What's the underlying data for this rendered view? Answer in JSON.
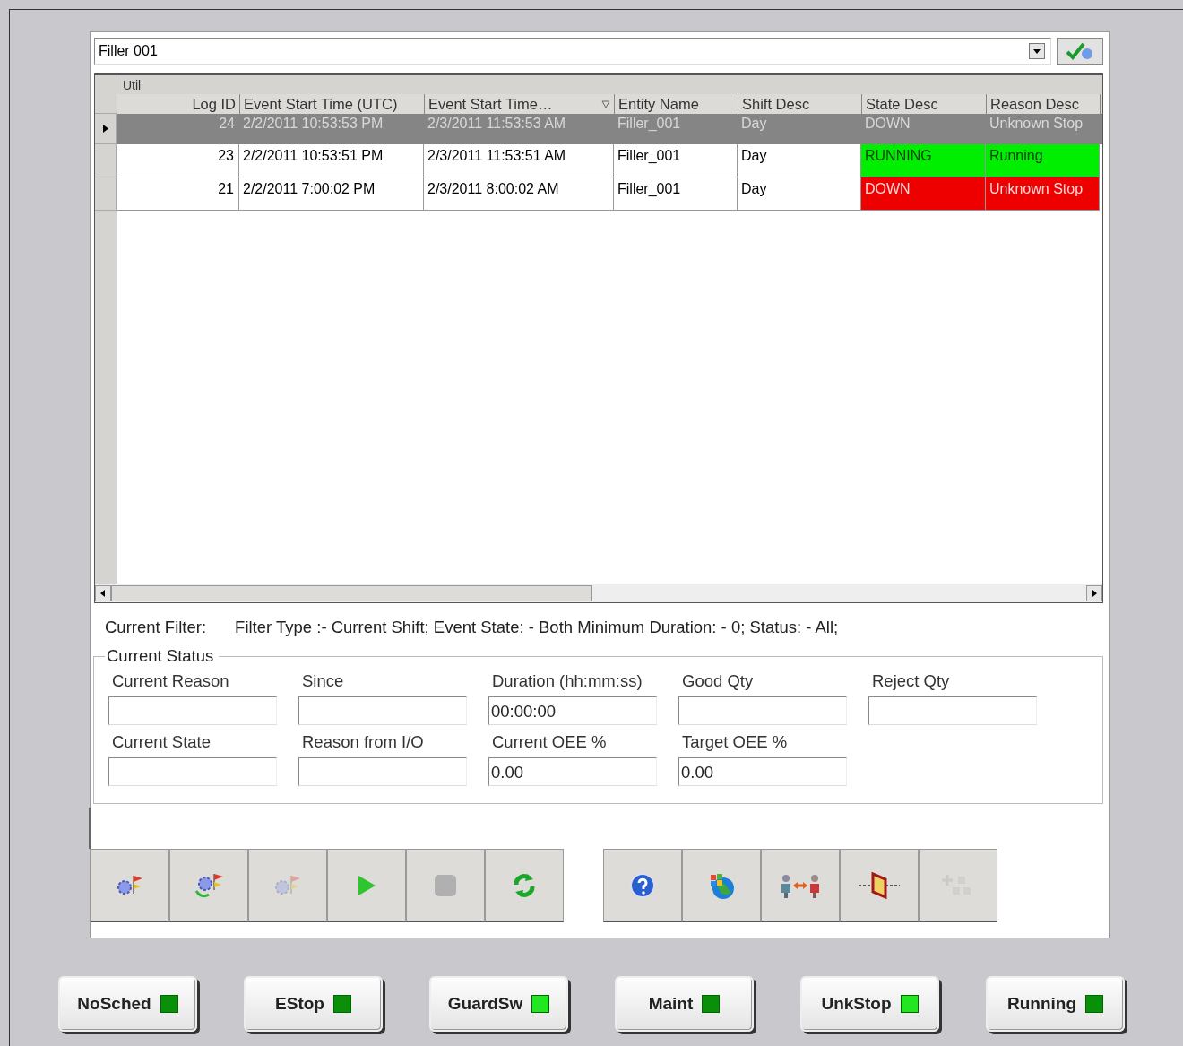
{
  "selector": {
    "value": "Filler 001"
  },
  "grid": {
    "group_header": "Util",
    "columns": [
      {
        "label": "Log ID",
        "sorted": false
      },
      {
        "label": "Event Start Time (UTC)",
        "sorted": false
      },
      {
        "label": "Event Start Time…",
        "sorted": true
      },
      {
        "label": "Entity Name",
        "sorted": false
      },
      {
        "label": "Shift Desc",
        "sorted": false
      },
      {
        "label": "State Desc",
        "sorted": false
      },
      {
        "label": "Reason Desc",
        "sorted": false
      }
    ],
    "rows": [
      {
        "selected": true,
        "cells": [
          "24",
          "2/2/2011 10:53:53 PM",
          "2/3/2011 11:53:53 AM",
          "Filler_001",
          "Day",
          "DOWN",
          "Unknown Stop"
        ]
      },
      {
        "selected": false,
        "color": "#00ee00",
        "cells": [
          "23",
          "2/2/2011 10:53:51 PM",
          "2/3/2011 11:53:51 AM",
          "Filler_001",
          "Day",
          "RUNNING",
          "Running"
        ]
      },
      {
        "selected": false,
        "color": "#ee0000",
        "cells": [
          "21",
          "2/2/2011 7:00:02 PM",
          "2/3/2011 8:00:02 AM",
          "Filler_001",
          "Day",
          "DOWN",
          "Unknown Stop"
        ]
      }
    ]
  },
  "filter": {
    "label": "Current Filter:",
    "text": "Filter Type :- Current Shift; Event State: - Both  Minimum Duration: - 0; Status: - All;"
  },
  "status": {
    "title": "Current Status",
    "fields": [
      {
        "label": "Current Reason"
      },
      {
        "label": "Since"
      },
      {
        "label": "Duration (hh:mm:ss)",
        "value": "00:00:00"
      },
      {
        "label": "Good Qty"
      },
      {
        "label": "Reject Qty"
      },
      {
        "label": "Current State"
      },
      {
        "label": "Reason from I/O"
      },
      {
        "label": "Current OEE %",
        "value": "0.00"
      },
      {
        "label": "Target OEE %",
        "value": "0.00"
      }
    ]
  },
  "toolbar": {
    "groups": [
      [
        {
          "kind": "filter-gear",
          "disabled": false
        },
        {
          "kind": "filter-gear-refresh",
          "disabled": false
        },
        {
          "kind": "filter-gear",
          "disabled": true
        },
        {
          "kind": "play",
          "disabled": false
        },
        {
          "kind": "stop",
          "disabled": true
        },
        {
          "kind": "refresh",
          "disabled": false
        }
      ],
      [
        {
          "kind": "help",
          "disabled": false
        },
        {
          "kind": "globe",
          "disabled": false
        },
        {
          "kind": "people-swap",
          "disabled": false
        },
        {
          "kind": "frame-line",
          "disabled": false
        },
        {
          "kind": "add-shapes",
          "disabled": true
        }
      ]
    ]
  },
  "indicators": [
    {
      "label": "NoSched",
      "color": "#0a8f0a"
    },
    {
      "label": "EStop",
      "color": "#0a8f0a"
    },
    {
      "label": "GuardSw",
      "color": "#22e622"
    },
    {
      "label": "Maint",
      "color": "#0a8f0a"
    },
    {
      "label": "UnkStop",
      "color": "#22e622"
    },
    {
      "label": "Running",
      "color": "#0a8f0a"
    }
  ]
}
